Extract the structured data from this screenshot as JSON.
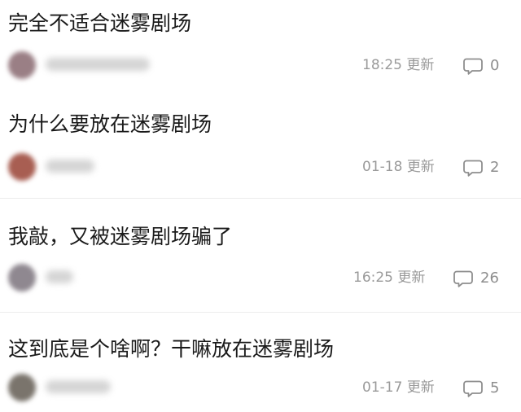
{
  "posts": [
    {
      "title": "完全不适合迷雾剧场",
      "time": "18:25",
      "updated": "更新",
      "comments": "0",
      "avatar_color": "#9a7f85"
    },
    {
      "title": "为什么要放在迷雾剧场",
      "time": "01-18",
      "updated": "更新",
      "comments": "2",
      "avatar_color": "#a85e52"
    },
    {
      "title": "我敲，又被迷雾剧场骗了",
      "time": "16:25",
      "updated": "更新",
      "comments": "26",
      "avatar_color": "#8f8890"
    },
    {
      "title": "这到底是个啥啊？干嘛放在迷雾剧场",
      "time": "01-17",
      "updated": "更新",
      "comments": "5",
      "avatar_color": "#7a746c"
    }
  ]
}
